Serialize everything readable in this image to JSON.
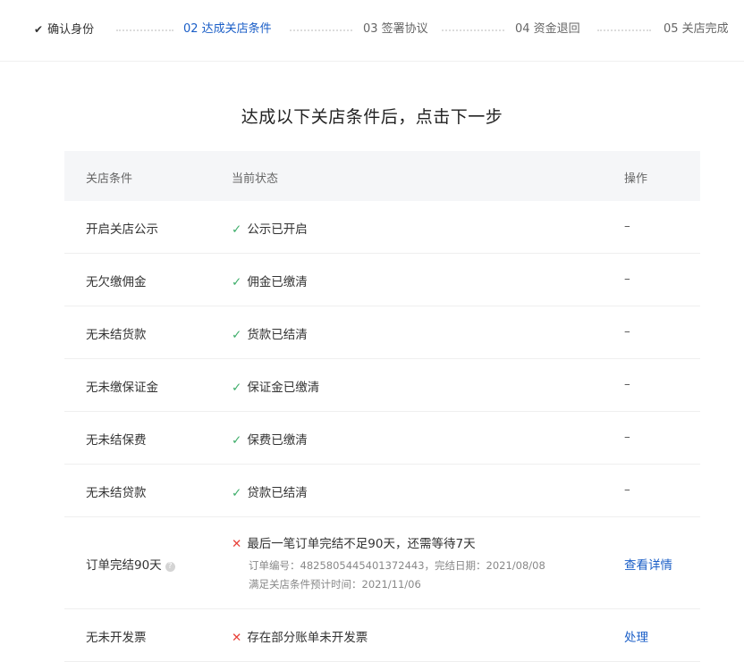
{
  "steps": [
    {
      "label": "确认身份",
      "state": "done"
    },
    {
      "label": "02 达成关店条件",
      "state": "active"
    },
    {
      "label": "03 签署协议",
      "state": "todo"
    },
    {
      "label": "04 资金退回",
      "state": "todo"
    },
    {
      "label": "05 关店完成",
      "state": "todo"
    }
  ],
  "icons": {
    "step_done": "check-icon",
    "status_ok": "check-icon",
    "status_fail": "cross-icon",
    "help": "question-circle-icon"
  },
  "colors": {
    "accent": "#1a5ec7",
    "ok": "#3fae6b",
    "fail": "#e8423a"
  },
  "heading": "达成以下关店条件后，点击下一步",
  "table": {
    "headers": [
      "关店条件",
      "当前状态",
      "操作"
    ],
    "rows": [
      {
        "condition": "开启关店公示",
        "status": "公示已开启",
        "ok": true,
        "action": "–"
      },
      {
        "condition": "无欠缴佣金",
        "status": "佣金已缴清",
        "ok": true,
        "action": "–"
      },
      {
        "condition": "无未结货款",
        "status": "货款已结清",
        "ok": true,
        "action": "–"
      },
      {
        "condition": "无未缴保证金",
        "status": "保证金已缴清",
        "ok": true,
        "action": "–"
      },
      {
        "condition": "无未结保费",
        "status": "保费已缴清",
        "ok": true,
        "action": "–"
      },
      {
        "condition": "无未结贷款",
        "status": "贷款已结清",
        "ok": true,
        "action": "–"
      },
      {
        "condition": "订单完结90天",
        "status": "最后一笔订单完结不足90天，还需等待7天",
        "ok": false,
        "detail1": "订单编号：4825805445401372443，完结日期：2021/08/08",
        "detail2": "满足关店条件预计时间：2021/11/06",
        "action": "查看详情"
      },
      {
        "condition": "无未开发票",
        "status": "存在部分账单未开发票",
        "ok": false,
        "action": "处理"
      }
    ]
  }
}
